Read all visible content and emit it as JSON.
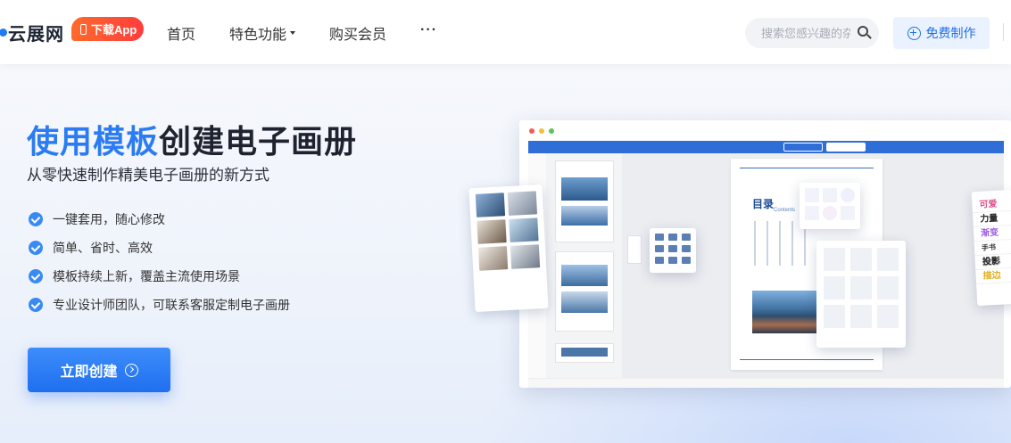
{
  "header": {
    "logo_text": "云展网",
    "app_badge": "下载App",
    "nav": [
      {
        "label": "首页"
      },
      {
        "label": "特色功能"
      },
      {
        "label": "购买会员"
      },
      {
        "label": "···"
      }
    ],
    "search_placeholder": "搜索您感兴趣的杂志",
    "free_button": "免费制作"
  },
  "hero": {
    "title_highlight": "使用模板",
    "title_rest": "创建电子画册",
    "subtitle": "从零快速制作精美电子画册的新方式",
    "features": [
      "一键套用，随心修改",
      "简单、省时、高效",
      "模板持续上新，覆盖主流使用场景",
      "专业设计师团队，可联系客服定制电子画册"
    ],
    "cta_label": "立即创建"
  },
  "mockup": {
    "toc_title": "目录",
    "toc_en": "Contents",
    "font_samples": [
      {
        "text": "可爱",
        "color": "#e0508a"
      },
      {
        "text": "力量",
        "color": "#222222"
      },
      {
        "text": "渐变",
        "color": "#9b5be0"
      },
      {
        "text": "手书",
        "color": "#333333"
      },
      {
        "text": "投影",
        "color": "#222222"
      },
      {
        "text": "描边",
        "color": "#e0b020"
      }
    ]
  },
  "colors": {
    "accent": "#2b7bf2",
    "cta": "#1f6ff0",
    "badge": "#ff4a33"
  }
}
